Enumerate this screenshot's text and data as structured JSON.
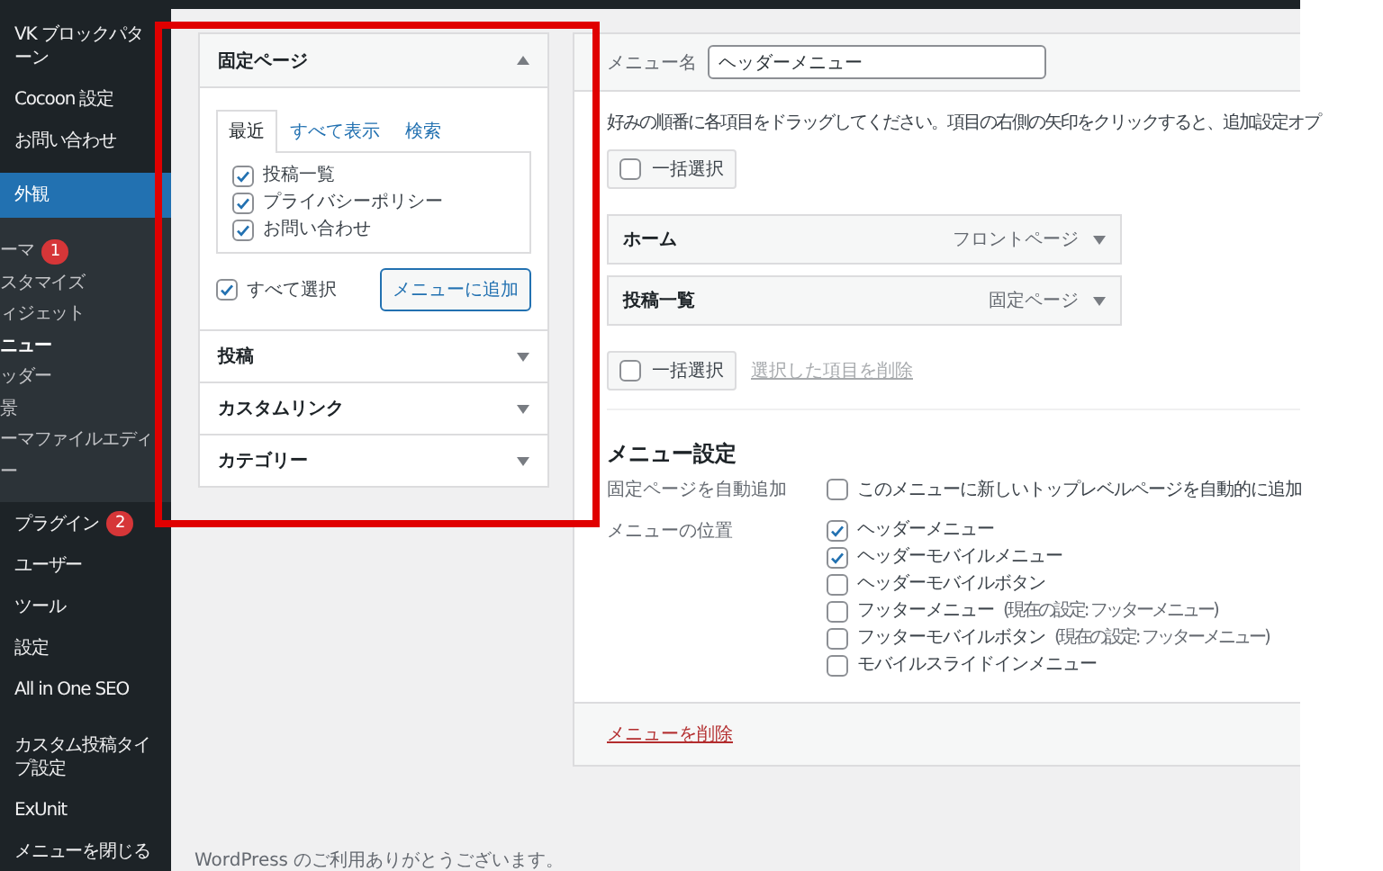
{
  "sidebar": {
    "items": [
      {
        "label": "VK ブロックパターン",
        "selected": false
      },
      {
        "label": "Cocoon 設定",
        "selected": false
      },
      {
        "label": "お問い合わせ",
        "selected": false
      },
      {
        "label": "外観",
        "selected": true,
        "children": [
          {
            "label": "ーマ",
            "badge": "1",
            "selected": false
          },
          {
            "label": "スタマイズ",
            "selected": false
          },
          {
            "label": "ィジェット",
            "selected": false
          },
          {
            "label": "ニュー",
            "selected": true
          },
          {
            "label": "ッダー",
            "selected": false
          },
          {
            "label": "景",
            "selected": false
          },
          {
            "label": "ーマファイルエディー",
            "selected": false
          }
        ]
      },
      {
        "label": "プラグイン",
        "badge": "2",
        "selected": false
      },
      {
        "label": "ユーザー",
        "selected": false
      },
      {
        "label": "ツール",
        "selected": false
      },
      {
        "label": "設定",
        "selected": false
      },
      {
        "label": "All in One SEO",
        "selected": false
      },
      {
        "label": "カスタム投稿タイプ設定",
        "selected": false
      },
      {
        "label": "ExUnit",
        "selected": false
      },
      {
        "label": "メニューを閉じる",
        "selected": false
      }
    ]
  },
  "add_items": {
    "sections": [
      {
        "title": "固定ページ",
        "expanded": true,
        "tabs": [
          {
            "label": "最近",
            "selected": true
          },
          {
            "label": "すべて表示",
            "selected": false
          },
          {
            "label": "検索",
            "selected": false
          }
        ],
        "items": [
          {
            "label": "投稿一覧",
            "checked": true
          },
          {
            "label": "プライバシーポリシー",
            "checked": true
          },
          {
            "label": "お問い合わせ",
            "checked": true
          }
        ],
        "select_all": {
          "label": "すべて選択",
          "checked": true
        },
        "button": "メニューに追加"
      },
      {
        "title": "投稿",
        "expanded": false
      },
      {
        "title": "カスタムリンク",
        "expanded": false
      },
      {
        "title": "カテゴリー",
        "expanded": false
      }
    ]
  },
  "menu_editor": {
    "name_label": "メニュー名",
    "name_value": "ヘッダーメニュー",
    "instructions": "好みの順番に各項目をドラッグしてください。項目の右側の矢印をクリックすると、追加設定オプ",
    "bulk_select_top": {
      "label": "一括選択",
      "checked": false
    },
    "menu_items": [
      {
        "title": "ホーム",
        "type": "フロントページ"
      },
      {
        "title": "投稿一覧",
        "type": "固定ページ"
      }
    ],
    "bulk_select_bottom": {
      "label": "一括選択",
      "checked": false
    },
    "remove_selected": "選択した項目を削除",
    "settings_title": "メニュー設定",
    "auto_add": {
      "label": "固定ページを自動追加",
      "option": "このメニューに新しいトップレベルページを自動的に追加",
      "checked": false
    },
    "locations_label": "メニューの位置",
    "locations": [
      {
        "label": "ヘッダーメニュー",
        "checked": true
      },
      {
        "label": "ヘッダーモバイルメニュー",
        "checked": true
      },
      {
        "label": "ヘッダーモバイルボタン",
        "checked": false
      },
      {
        "label": "フッターメニュー",
        "note": "(現在の設定: フッターメニュー)",
        "checked": false
      },
      {
        "label": "フッターモバイルボタン",
        "note": "(現在の設定: フッターメニュー)",
        "checked": false
      },
      {
        "label": "モバイルスライドインメニュー",
        "checked": false
      }
    ],
    "delete_link": "メニューを削除"
  },
  "footer": "WordPress のご利用ありがとうございます。"
}
